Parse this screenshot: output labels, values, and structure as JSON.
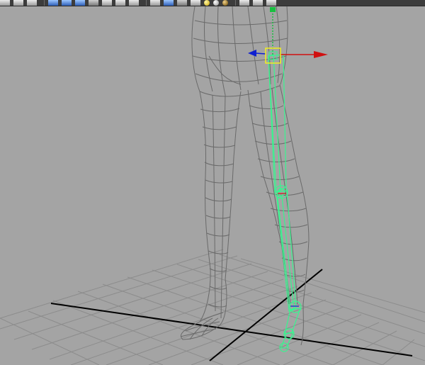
{
  "toolbar": {
    "icons": [
      "grid-icon",
      "wireframe-icon",
      "camera-icon",
      "shaded-icon",
      "texture-icon",
      "lighting-icon",
      "xray-icon",
      "isolate-icon",
      "resolution-gate-icon",
      "camera-attributes-icon",
      "bookmark-icon",
      "image-plane-icon",
      "default-material-icon",
      "shadow-icon",
      "ambient-occlusion-icon",
      "motion-blur-icon",
      "transform-tool-icon",
      "panel-layout-icon",
      "two-pane-icon",
      "link-icon"
    ]
  },
  "viewport": {
    "mode": "wireframe",
    "background_color": "#a4a4a4",
    "grid_color": "#8c8c8c",
    "axis_color": "#000000",
    "mesh_color": "#6a6a6a",
    "skeleton_color": "#38f58f",
    "manipulator": {
      "x_axis_color": "#d01010",
      "y_axis_color": "#18c040",
      "z_axis_color": "#1020d0",
      "center_color": "#f0f020"
    }
  }
}
